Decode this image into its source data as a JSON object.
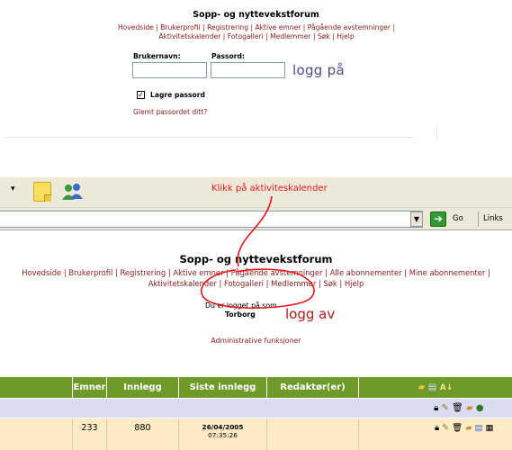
{
  "top_panel": {
    "title": "Sopp- og nyttevekstforum",
    "nav": [
      "Hovedside",
      "Brukerprofil",
      "Registrering",
      "Aktive emner",
      "Pågående avstemninger",
      "Aktivitetskalender",
      "Fotogalleri",
      "Medlemmer",
      "Søk",
      "Hjelp"
    ],
    "username_label": "Brukernavn:",
    "password_label": "Passord:",
    "login_label": "logg på",
    "remember_label": "Lagre passord",
    "remember_checked": true,
    "forgot_label": "Glemt passordet ditt?"
  },
  "browser": {
    "go_label": "Go",
    "links_label": "Links",
    "icons": [
      "chevron-down-icon",
      "sticky-note-icon",
      "messenger-people-icon",
      "dropdown-arrow-icon",
      "go-arrow-icon"
    ]
  },
  "annotation": {
    "text": "Klikk på aktiviteskalender",
    "color": "#e8161b"
  },
  "page": {
    "title": "Sopp- og nyttevekstforum",
    "nav": [
      "Hovedside",
      "Brukerprofil",
      "Registrering",
      "Aktive emner",
      "Pågående avstemninger",
      "Alle abonnementer",
      "Mine abonnementer",
      "Aktivitetskalender",
      "Fotogalleri",
      "Medlemmer",
      "Søk",
      "Hjelp"
    ],
    "logged_in_as": "Du er logget på som",
    "username": "Torborg",
    "logout_label": "logg av",
    "admin_label": "Administrative funksjoner"
  },
  "table": {
    "header_color": "#6e9a2a",
    "columns": [
      "Emner",
      "Innlegg",
      "Siste innlegg",
      "Redaktør(er)"
    ],
    "rows": [
      {
        "emner": "233",
        "innlegg": "880",
        "siste_date": "26/04/2005",
        "siste_time": "07:35:26",
        "redaktor": ""
      }
    ]
  }
}
